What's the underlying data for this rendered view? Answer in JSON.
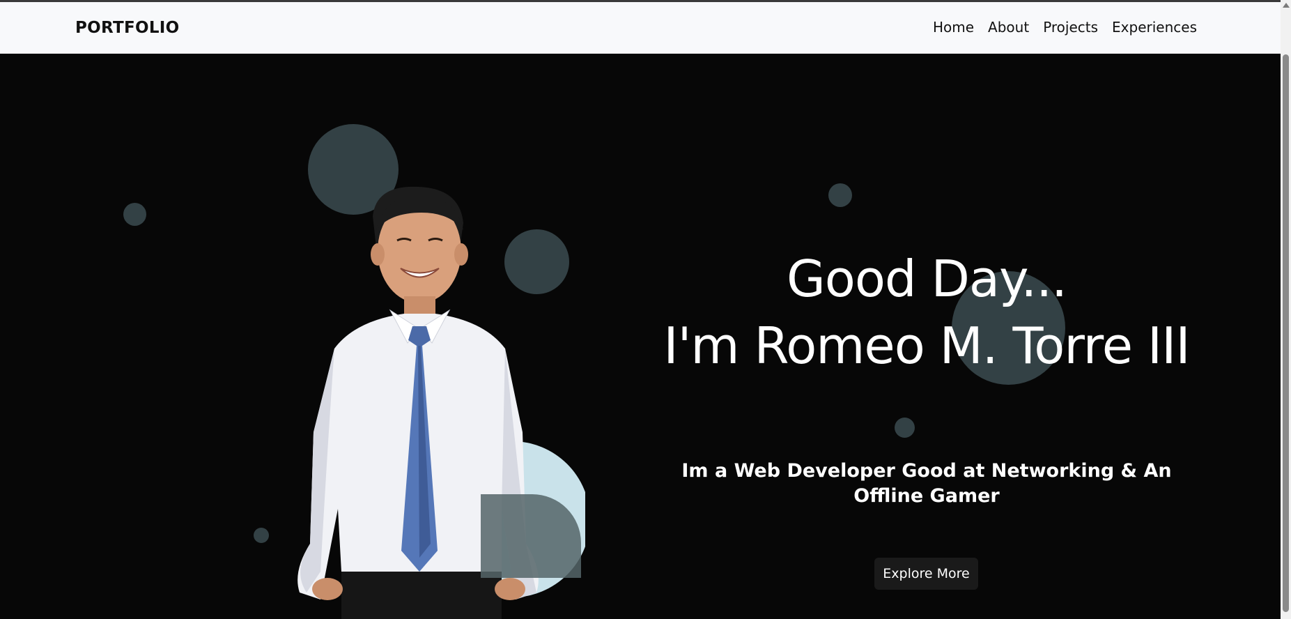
{
  "navbar": {
    "brand": "PORTFOLIO",
    "links": [
      "Home",
      "About",
      "Projects",
      "Experiences"
    ]
  },
  "hero": {
    "greeting": "Good Day...",
    "name_line": "I'm Romeo M. Torre III",
    "tagline": "Im a Web Developer Good at Networking & An Offline Gamer",
    "cta_label": "Explore More"
  },
  "colors": {
    "navbar_bg": "#f8f9fb",
    "hero_bg": "#070707",
    "bubble": "#334145",
    "bubble_light": "#c9e2ea",
    "text_primary": "#ffffff",
    "button_bg": "#1a1a1a"
  },
  "icons": {
    "scroll_up": "triangle-up"
  }
}
